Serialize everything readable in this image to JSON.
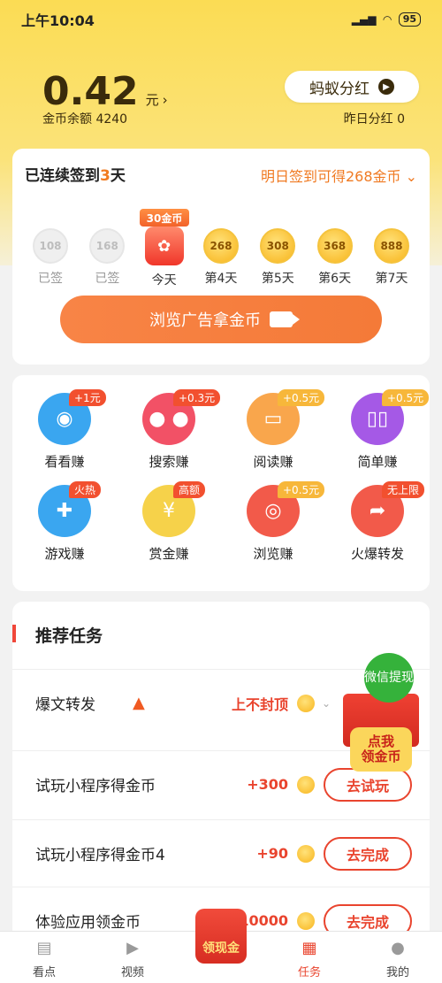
{
  "status_bar": {
    "time": "上午10:04",
    "signal": "4G",
    "battery": "95"
  },
  "header": {
    "balance": "0.42",
    "unit": "元",
    "arrow": "›",
    "coin_balance": "金币余额 4240",
    "ant_dividend": "蚂蚁分红",
    "yesterday_dividend": "昨日分红 0"
  },
  "signin": {
    "prefix": "已连续签到",
    "days": "3",
    "suffix": "天",
    "tomorrow": "明日签到可得268金币",
    "today_badge": "30金币",
    "items": [
      {
        "value": "108",
        "label": "已签",
        "state": "done"
      },
      {
        "value": "168",
        "label": "已签",
        "state": "done"
      },
      {
        "value": "",
        "label": "今天",
        "state": "today"
      },
      {
        "value": "268",
        "label": "第4天",
        "state": "future"
      },
      {
        "value": "308",
        "label": "第5天",
        "state": "future"
      },
      {
        "value": "368",
        "label": "第6天",
        "state": "future"
      },
      {
        "value": "888",
        "label": "第7天",
        "state": "future"
      }
    ],
    "ad_button": "浏览广告拿金币"
  },
  "earn": [
    {
      "label": "看看赚",
      "badge": "+1元",
      "icon": "eye-icon",
      "color": "#3aa6f0"
    },
    {
      "label": "搜索赚",
      "badge": "+0.3元",
      "icon": "search-coins-icon",
      "color": "#f25166"
    },
    {
      "label": "阅读赚",
      "badge": "+0.5元",
      "icon": "book-icon",
      "color": "#f9a64c"
    },
    {
      "label": "简单赚",
      "badge": "+0.5元",
      "icon": "open-book-icon",
      "color": "#a559e6"
    },
    {
      "label": "游戏赚",
      "badge": "火热",
      "icon": "gamepad-icon",
      "color": "#3aa6f0"
    },
    {
      "label": "赏金赚",
      "badge": "高额",
      "icon": "money-bag-icon",
      "color": "#f6d24a"
    },
    {
      "label": "浏览赚",
      "badge": "+0.5元",
      "icon": "browser-icon",
      "color": "#f25a4a"
    },
    {
      "label": "火爆转发",
      "badge": "无上限",
      "icon": "share-icon",
      "color": "#f25a4a"
    }
  ],
  "tasks": {
    "title": "推荐任务",
    "items": [
      {
        "name": "爆文转发",
        "reward": "上不封顶",
        "button": ""
      },
      {
        "name": "试玩小程序得金币",
        "reward": "+300",
        "button": "去试玩"
      },
      {
        "name": "试玩小程序得金币4",
        "reward": "+90",
        "button": "去完成"
      },
      {
        "name": "体验应用领金币",
        "reward": "+10000",
        "button": "去完成"
      }
    ]
  },
  "float_promo": {
    "wechat": "微信提现",
    "tag_line1": "点我",
    "tag_line2": "领金币"
  },
  "tabbar": {
    "items": [
      {
        "label": "看点",
        "icon": "article-icon"
      },
      {
        "label": "视频",
        "icon": "play-icon"
      },
      {
        "label": "领现金",
        "icon": "red-packet-icon"
      },
      {
        "label": "任务",
        "icon": "task-icon"
      },
      {
        "label": "我的",
        "icon": "profile-icon"
      }
    ],
    "active": "任务"
  }
}
